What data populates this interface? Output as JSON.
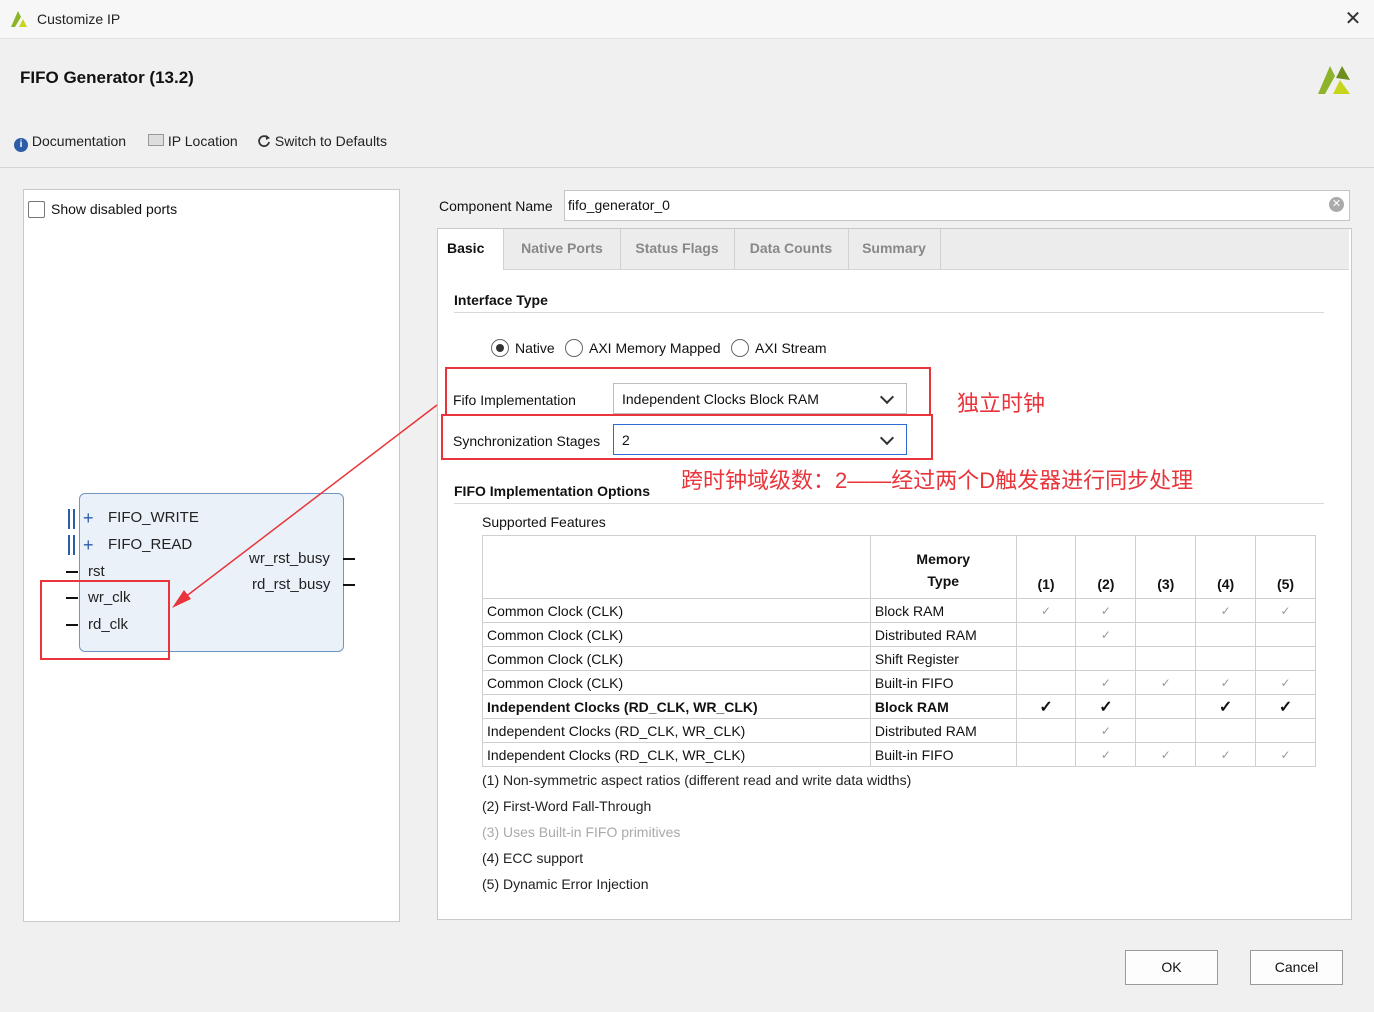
{
  "window": {
    "title": "Customize IP",
    "close_glyph": "✕"
  },
  "header": {
    "title": "FIFO Generator (13.2)"
  },
  "toolbar": {
    "documentation": "Documentation",
    "ip_location": "IP Location",
    "switch_defaults": "Switch to Defaults"
  },
  "left_panel": {
    "show_disabled_ports": "Show disabled ports",
    "block": {
      "left_ports": [
        "FIFO_WRITE",
        "FIFO_READ",
        "rst",
        "wr_clk",
        "rd_clk"
      ],
      "right_ports": [
        "wr_rst_busy",
        "rd_rst_busy"
      ]
    }
  },
  "component": {
    "label": "Component Name",
    "value": "fifo_generator_0"
  },
  "tabs": [
    "Basic",
    "Native Ports",
    "Status Flags",
    "Data Counts",
    "Summary"
  ],
  "basic": {
    "interface_type_title": "Interface Type",
    "interface_options": [
      "Native",
      "AXI Memory Mapped",
      "AXI Stream"
    ],
    "interface_selected": "Native",
    "fifo_impl_label": "Fifo Implementation",
    "fifo_impl_value": "Independent Clocks Block RAM",
    "sync_stages_label": "Synchronization Stages",
    "sync_stages_value": "2",
    "options_title": "FIFO Implementation Options",
    "supported_features": "Supported Features",
    "table_headers": [
      "",
      "Memory Type",
      "(1)",
      "(2)",
      "(3)",
      "(4)",
      "(5)"
    ],
    "table_rows": [
      {
        "clock": "Common Clock (CLK)",
        "memory": "Block RAM",
        "flags": [
          "✓",
          "✓",
          "",
          "✓",
          "✓"
        ]
      },
      {
        "clock": "Common Clock (CLK)",
        "memory": "Distributed RAM",
        "flags": [
          "",
          "✓",
          "",
          "",
          ""
        ]
      },
      {
        "clock": "Common Clock (CLK)",
        "memory": "Shift Register",
        "flags": [
          "",
          "",
          "",
          "",
          ""
        ]
      },
      {
        "clock": "Common Clock (CLK)",
        "memory": "Built-in FIFO",
        "flags": [
          "",
          "✓",
          "✓",
          "✓",
          "✓"
        ]
      },
      {
        "clock": "Independent Clocks (RD_CLK, WR_CLK)",
        "memory": "Block RAM",
        "flags": [
          "✓",
          "✓",
          "",
          "✓",
          "✓"
        ]
      },
      {
        "clock": "Independent Clocks (RD_CLK, WR_CLK)",
        "memory": "Distributed RAM",
        "flags": [
          "",
          "✓",
          "",
          "",
          ""
        ]
      },
      {
        "clock": "Independent Clocks (RD_CLK, WR_CLK)",
        "memory": "Built-in FIFO",
        "flags": [
          "",
          "✓",
          "✓",
          "✓",
          "✓"
        ]
      }
    ],
    "notes": [
      "(1) Non-symmetric aspect ratios (different read and write data widths)",
      "(2) First-Word Fall-Through",
      "(3) Uses Built-in FIFO primitives",
      "(4) ECC support",
      "(5) Dynamic Error Injection"
    ]
  },
  "annotations": {
    "impl_note": "独立时钟",
    "sync_note": "跨时钟域级数：2——经过两个D触发器进行同步处理"
  },
  "buttons": {
    "ok": "OK",
    "cancel": "Cancel"
  },
  "colors": {
    "annotation_red": "#e8343a",
    "xilinx_logo": "#8db32b"
  }
}
